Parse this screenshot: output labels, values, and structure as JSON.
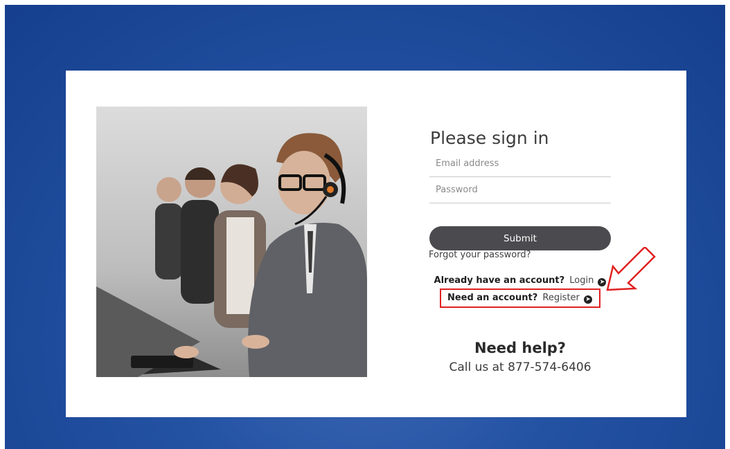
{
  "signin": {
    "title": "Please sign in",
    "email_placeholder": "Email address",
    "password_placeholder": "Password",
    "submit_label": "Submit",
    "forgot_label": "Forgot your password?"
  },
  "account_links": {
    "login_prompt": "Already have an account?",
    "login_label": "Login",
    "register_prompt": "Need an account?",
    "register_label": "Register",
    "link_icon": "circle-arrow-right-icon"
  },
  "help": {
    "title": "Need help?",
    "phone_text": "Call us at 877-574-6406"
  },
  "colors": {
    "background_blue": "#2452a3",
    "button": "#4b4b4f",
    "highlight_red": "#e02020"
  }
}
